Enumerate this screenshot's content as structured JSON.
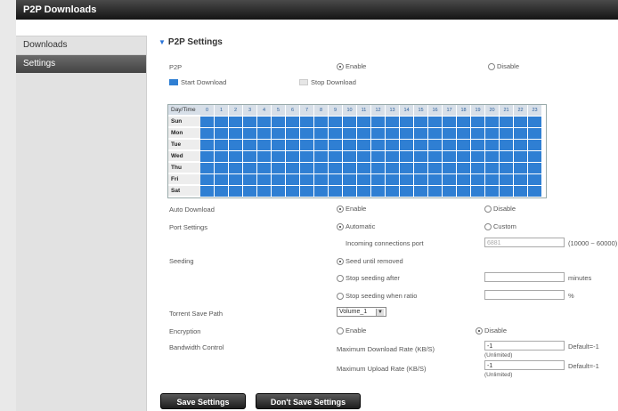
{
  "window": {
    "title": "P2P Downloads"
  },
  "sidebar": {
    "items": [
      {
        "label": "Downloads"
      },
      {
        "label": "Settings"
      }
    ]
  },
  "section": {
    "title": "P2P Settings"
  },
  "p2p": {
    "label": "P2P",
    "enable": "Enable",
    "disable": "Disable"
  },
  "legend": {
    "start": "Start Download",
    "stop": "Stop Download"
  },
  "schedule": {
    "header": "Day/Time",
    "hours": [
      "0",
      "1",
      "2",
      "3",
      "4",
      "5",
      "6",
      "7",
      "8",
      "9",
      "10",
      "11",
      "12",
      "13",
      "14",
      "15",
      "16",
      "17",
      "18",
      "19",
      "20",
      "21",
      "22",
      "23"
    ],
    "days": [
      "Sun",
      "Mon",
      "Tue",
      "Wed",
      "Thu",
      "Fri",
      "Sat"
    ]
  },
  "auto_download": {
    "label": "Auto Download",
    "enable": "Enable",
    "disable": "Disable"
  },
  "port_settings": {
    "label": "Port Settings",
    "automatic": "Automatic",
    "custom": "Custom",
    "incoming_label": "Incoming connections port",
    "incoming_value": "6881",
    "range": "(10000 ~ 60000)"
  },
  "seeding": {
    "label": "Seeding",
    "seed_until": "Seed until removed",
    "stop_after": "Stop seeding after",
    "stop_after_unit": "minutes",
    "stop_ratio": "Stop seeding when ratio",
    "stop_ratio_unit": "%"
  },
  "torrent_save_path": {
    "label": "Torrent Save Path",
    "value": "Volume_1"
  },
  "encryption": {
    "label": "Encryption",
    "enable": "Enable",
    "disable": "Disable"
  },
  "bandwidth": {
    "label": "Bandwidth Control",
    "max_download_label": "Maximum Download Rate (KB/S)",
    "max_download_value": "-1",
    "max_download_default": "Default=-1",
    "max_download_hint": "(Unlimited)",
    "max_upload_label": "Maximum Upload Rate (KB/S)",
    "max_upload_value": "-1",
    "max_upload_default": "Default=-1",
    "max_upload_hint": "(Unlimited)"
  },
  "buttons": {
    "save": "Save Settings",
    "dont_save": "Don't Save Settings"
  },
  "colors": {
    "accent": "#2f7fd3",
    "stop": "#e6e6e6"
  }
}
